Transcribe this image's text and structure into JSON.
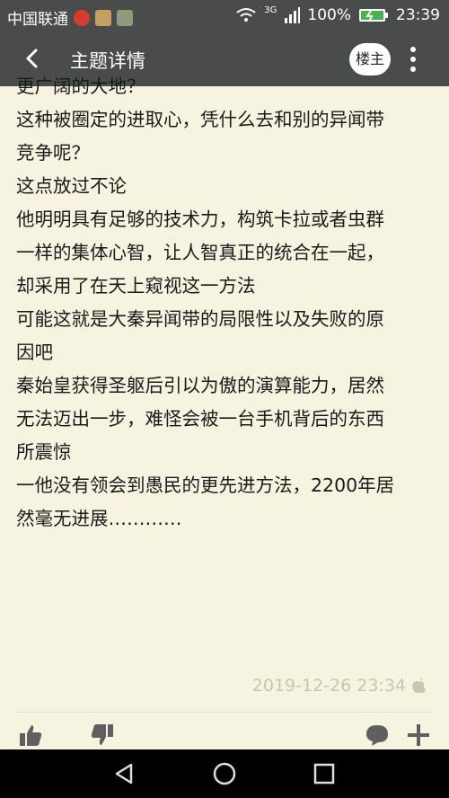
{
  "status_bar": {
    "carrier": "中国联通",
    "network": "3G",
    "battery": "100%",
    "time": "23:39"
  },
  "app_bar": {
    "title": "主题详情",
    "author_button": "楼主"
  },
  "post": {
    "lines": [
      "更广阔的大地？",
      "",
      "这种被圈定的进取心，凭什么去和别的异闻带",
      "竞争呢？",
      "",
      "这点放过不论",
      "他明明具有足够的技术力，构筑卡拉或者虫群",
      "一样的集体心智，让人智真正的统合在一起，",
      "却采用了在天上窥视这一方法",
      "",
      "可能这就是大秦异闻带的局限性以及失败的原",
      "因吧",
      "秦始皇获得圣躯后引以为傲的演算能力，居然",
      "无法迈出一步，难怪会被一台手机背后的东西",
      "所震惊",
      "一他没有领会到愚民的更先进方法，2200年居",
      "然毫无进展…………"
    ],
    "timestamp": "2019-12-26 23:34"
  },
  "icons": {
    "back": "back-arrow-icon",
    "more": "more-vert-icon",
    "like": "thumbs-up-icon",
    "dislike": "thumbs-down-icon",
    "comment": "comment-icon",
    "add": "plus-icon",
    "nav_back": "triangle-back-icon",
    "nav_home": "circle-home-icon",
    "nav_recent": "square-recents-icon"
  },
  "colors": {
    "bar": "#4a4c4b",
    "background": "#f6f4e1",
    "text": "#1a1a1a",
    "timestamp": "#c9c6ac",
    "icon": "#5f5f5f",
    "battery": "#4caf50"
  }
}
